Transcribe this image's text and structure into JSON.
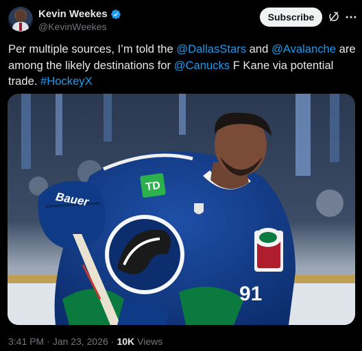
{
  "author": {
    "name": "Kevin Weekes",
    "handle": "@KevinWeekes",
    "verified_badge_color": "#1d9bf0"
  },
  "actions": {
    "subscribe_label": "Subscribe",
    "grok_icon": "grok-icon",
    "more_icon": "more-icon"
  },
  "tweet": {
    "segments": [
      {
        "type": "text",
        "text": "Per multiple sources, I’m told the "
      },
      {
        "type": "mention",
        "text": "@DallasStars"
      },
      {
        "type": "text",
        "text": " and "
      },
      {
        "type": "mention",
        "text": "@Avalanche"
      },
      {
        "type": "text",
        "text": " are among the likely destinations for "
      },
      {
        "type": "mention",
        "text": "@Canucks"
      },
      {
        "type": "text",
        "text": " F Kane via potential trade. "
      },
      {
        "type": "hashtag",
        "text": "#HockeyX"
      }
    ],
    "link_color": "#1d9bf0"
  },
  "media": {
    "glove_brand": "Bauer",
    "jersey_number": "91"
  },
  "meta": {
    "time": "3:41 PM",
    "separator": "·",
    "date": "Jan 23, 2026",
    "views_count": "10K",
    "views_label": "Views"
  }
}
